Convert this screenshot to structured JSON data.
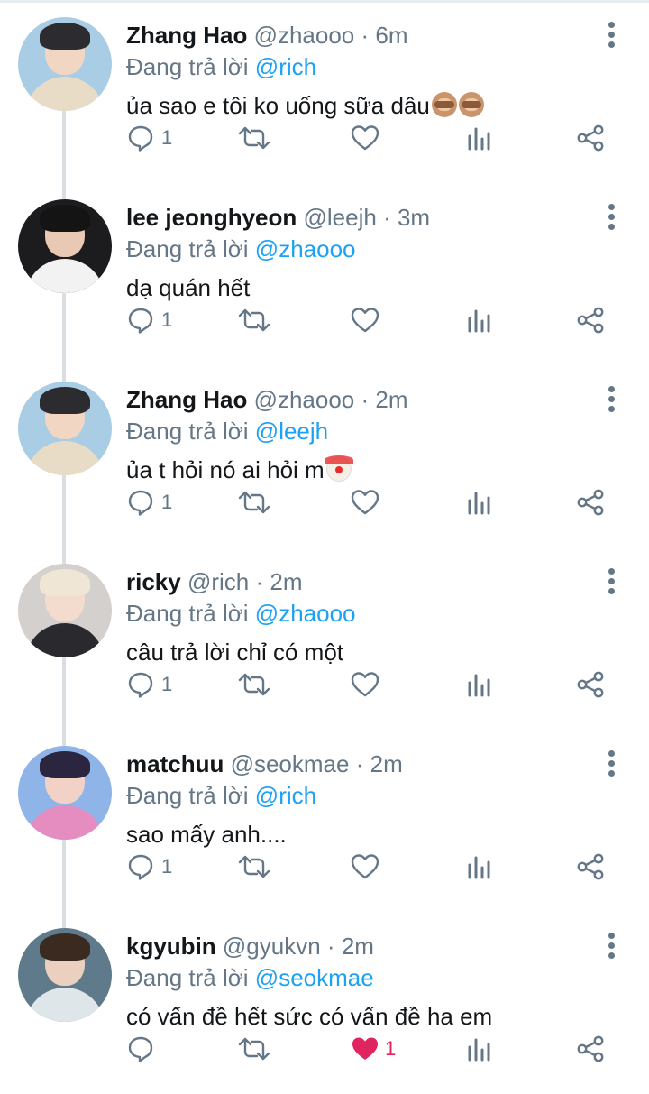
{
  "reply_prefix": "Đang trả lời",
  "tweets": [
    {
      "name": "Zhang Hao",
      "handle": "@zhaooo",
      "separator": "·",
      "time": "6m",
      "replying_to": "@rich",
      "text": "ủa sao e tôi ko uống sữa dâu",
      "emoji": [
        "monkey-face",
        "monkey-face"
      ],
      "reply_count": "1",
      "retweet_count": "",
      "like_count": "",
      "liked": false,
      "avatar_colors": {
        "bg": "#a9cde4",
        "hair": "#2b2b30",
        "skin": "#f1d6c4",
        "body": "#e9dcc6"
      }
    },
    {
      "name": "lee jeonghyeon",
      "handle": "@leejh",
      "separator": "·",
      "time": "3m",
      "replying_to": "@zhaooo",
      "text": "dạ quán hết",
      "emoji": [],
      "reply_count": "1",
      "retweet_count": "",
      "like_count": "",
      "liked": false,
      "avatar_colors": {
        "bg": "#1c1c1f",
        "hair": "#141414",
        "skin": "#e9c9b4",
        "body": "#f2f2f2"
      }
    },
    {
      "name": "Zhang Hao",
      "handle": "@zhaooo",
      "separator": "·",
      "time": "2m",
      "replying_to": "@leejh",
      "text": "ủa t hỏi nó ai hỏi m",
      "emoji": [
        "clown-face"
      ],
      "reply_count": "1",
      "retweet_count": "",
      "like_count": "",
      "liked": false,
      "avatar_colors": {
        "bg": "#a9cde4",
        "hair": "#2b2b30",
        "skin": "#f1d6c4",
        "body": "#e9dcc6"
      }
    },
    {
      "name": "ricky",
      "handle": "@rich",
      "separator": "·",
      "time": "2m",
      "replying_to": "@zhaooo",
      "text": "câu trả lời chỉ có một",
      "emoji": [],
      "reply_count": "1",
      "retweet_count": "",
      "like_count": "",
      "liked": false,
      "avatar_colors": {
        "bg": "#d4d0cd",
        "hair": "#efe6d6",
        "skin": "#f3dccd",
        "body": "#2a2a2e"
      }
    },
    {
      "name": "matchuu",
      "handle": "@seokmae",
      "separator": "·",
      "time": "2m",
      "replying_to": "@rich",
      "text": "sao mấy anh....",
      "emoji": [],
      "reply_count": "1",
      "retweet_count": "",
      "like_count": "",
      "liked": false,
      "avatar_colors": {
        "bg": "#8fb4e8",
        "hair": "#2c2540",
        "skin": "#f2d2c6",
        "body": "#e58cc0"
      }
    },
    {
      "name": "kgyubin",
      "handle": "@gyukvn",
      "separator": "·",
      "time": "2m",
      "replying_to": "@seokmae",
      "text": "có vấn đề hết sức có vấn đề ha em",
      "emoji": [],
      "reply_count": "",
      "retweet_count": "",
      "like_count": "1",
      "liked": true,
      "avatar_colors": {
        "bg": "#5f7a8a",
        "hair": "#3a2a20",
        "skin": "#ecd0bf",
        "body": "#dfe6ea"
      }
    }
  ],
  "colors": {
    "mention": "#1da1f2",
    "secondary_text": "#657786",
    "primary_text": "#14171a",
    "like_active": "#e0245e",
    "thread_line": "#d9dee2"
  },
  "icons": {
    "reply": "reply-icon",
    "retweet": "retweet-icon",
    "like": "heart-icon",
    "analytics": "analytics-icon",
    "share": "share-icon",
    "more": "more-options-icon"
  }
}
